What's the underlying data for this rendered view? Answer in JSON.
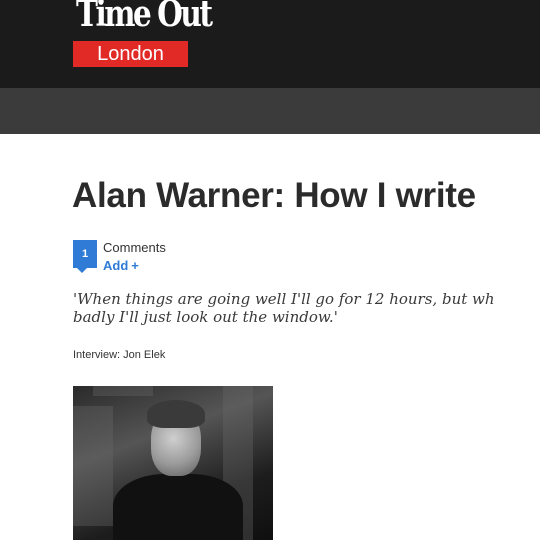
{
  "header": {
    "logo_wordmark": "Time Out",
    "logo_city": "London"
  },
  "article": {
    "title": "Alan Warner: How I write",
    "comments": {
      "count": "1",
      "label": "Comments",
      "add_label": "Add",
      "add_icon": "plus-icon"
    },
    "standfirst": "'When things are going well I'll go for 12 hours, but wh\nbadly I'll just look out the window.'",
    "byline": "Interview: Jon Elek",
    "photo": "author-portrait"
  },
  "colors": {
    "topbar": "#1b1b1b",
    "navbar": "#3b3b3b",
    "brand_red": "#e12a26",
    "link_blue": "#2f7bd6"
  }
}
